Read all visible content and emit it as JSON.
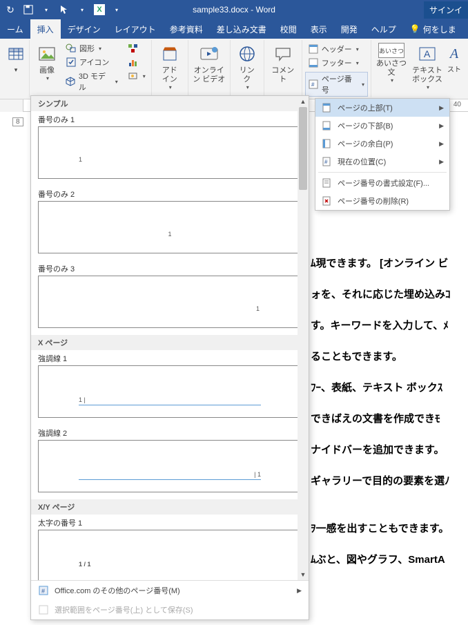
{
  "title": "sample33.docx - Word",
  "signin": "サインイ",
  "tabs": {
    "home": "ーム",
    "insert": "挿入",
    "design": "デザイン",
    "layout": "レイアウト",
    "references": "参考資料",
    "mailings": "差し込み文書",
    "review": "校閲",
    "view": "表示",
    "developer": "開発",
    "help": "ヘルプ",
    "tell": "何をしま"
  },
  "ribbon": {
    "image": "画像",
    "shapes": "図形",
    "icons": "アイコン",
    "models3d": "3D モデル",
    "addins": "アド\nイン",
    "onlinevideo": "オンライ\nン ビデオ",
    "link": "リン\nク",
    "comment": "コメント",
    "header": "ヘッダー",
    "footer": "フッター",
    "pagenumber": "ページ番号",
    "greeting": "あいさつ\n文",
    "textbox": "テキスト\nボックス",
    "quickparts": "スト"
  },
  "submenu": {
    "top": "ページの上部(T)",
    "bottom": "ページの下部(B)",
    "margins": "ページの余白(P)",
    "current": "現在の位置(C)",
    "format": "ページ番号の書式設定(F)...",
    "remove": "ページ番号の削除(R)"
  },
  "gallery": {
    "sec_simple": "シンプル",
    "item_num1": "番号のみ 1",
    "item_num2": "番号のみ 2",
    "item_num3": "番号のみ 3",
    "sec_xpage": "X ページ",
    "item_acc1": "強調線 1",
    "item_acc2": "強調線 2",
    "sec_xy": "X/Y ページ",
    "item_bold1": "太字の番号 1",
    "more": "Office.com のその他のページ番号(M)",
    "save": "選択範囲をページ番号(上) として保存(S)"
  },
  "doc": {
    "l1": "ﾑ現できます。 [オンライン ビ",
    "l2": "ォを、それに応じた埋め込みｺ",
    "l3": "す。キーワードを入力して、ﾒ",
    "l4": "ることもできます。",
    "l5": "ﾌｰ、表紙、テキスト ボックｽ",
    "l6": "できばえの文書を作成できﾓ",
    "l7": "ナイドバーを追加できます。",
    "l8": "ギャラリーで目的の要素を選ﾉ",
    "l9": "ｦ一感を出すこともできます。",
    "l10": "ﾑぶと、図やグラフ、SmartA"
  },
  "ruler": {
    "pos8": "8",
    "pos40": "40"
  }
}
